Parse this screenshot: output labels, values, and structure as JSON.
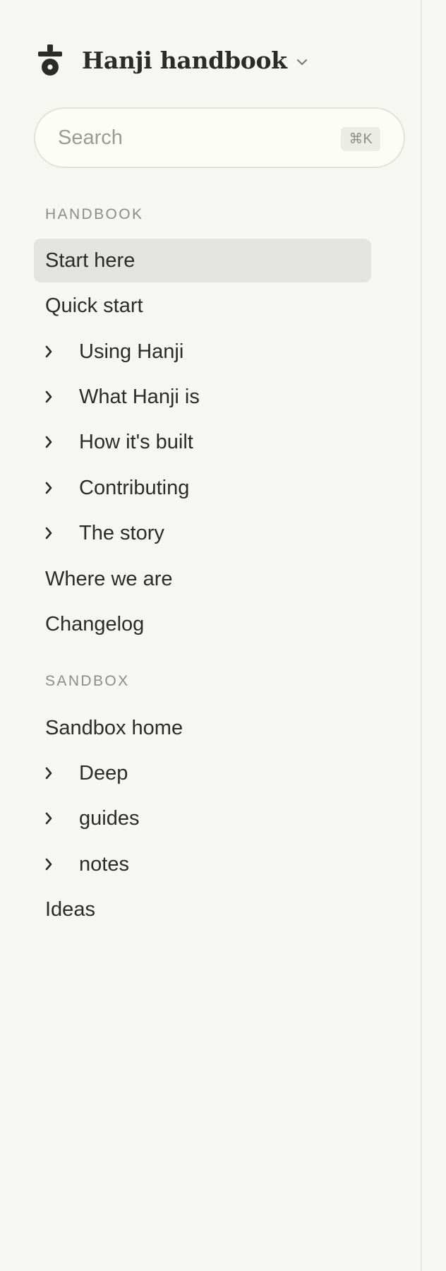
{
  "brand": {
    "title": "Hanji handbook",
    "logo_icon": "hanji-logo-icon",
    "menu_icon": "chevron-down-icon"
  },
  "search": {
    "placeholder": "Search",
    "value": "",
    "shortcut": "⌘K",
    "icon": "search-input"
  },
  "sections": [
    {
      "label": "HANDBOOK",
      "items": [
        {
          "label": "Start here",
          "expandable": false,
          "active": true
        },
        {
          "label": "Quick start",
          "expandable": false,
          "active": false
        },
        {
          "label": "Using Hanji",
          "expandable": true,
          "active": false
        },
        {
          "label": "What Hanji is",
          "expandable": true,
          "active": false
        },
        {
          "label": "How it's built",
          "expandable": true,
          "active": false
        },
        {
          "label": "Contributing",
          "expandable": true,
          "active": false
        },
        {
          "label": "The story",
          "expandable": true,
          "active": false
        },
        {
          "label": "Where we are",
          "expandable": false,
          "active": false
        },
        {
          "label": "Changelog",
          "expandable": false,
          "active": false
        }
      ]
    },
    {
      "label": "SANDBOX",
      "items": [
        {
          "label": "Sandbox home",
          "expandable": false,
          "active": false
        },
        {
          "label": "Deep",
          "expandable": true,
          "active": false
        },
        {
          "label": "guides",
          "expandable": true,
          "active": false
        },
        {
          "label": "notes",
          "expandable": true,
          "active": false
        },
        {
          "label": "Ideas",
          "expandable": false,
          "active": false
        }
      ]
    }
  ],
  "icons": {
    "expand": "chevron-right-icon"
  },
  "colors": {
    "background": "#f6f6f3",
    "active_item": "#e3e4df",
    "text": "#2b2b29",
    "muted": "#8c8c88"
  }
}
